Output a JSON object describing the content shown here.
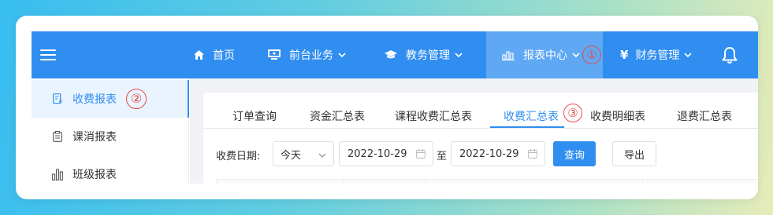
{
  "nav": {
    "items": [
      {
        "label": "首页",
        "icon": "home-icon"
      },
      {
        "label": "前台业务",
        "icon": "monitor-icon"
      },
      {
        "label": "教务管理",
        "icon": "graduation-cap-icon"
      },
      {
        "label": "报表中心",
        "icon": "bar-chart-icon",
        "active": true,
        "marker": "①"
      },
      {
        "label": "财务管理",
        "icon": "yen-icon"
      }
    ]
  },
  "sidebar": {
    "items": [
      {
        "label": "收费报表",
        "icon": "receipt-icon",
        "active": true,
        "marker": "②"
      },
      {
        "label": "课消报表",
        "icon": "clipboard-icon"
      },
      {
        "label": "班级报表",
        "icon": "bar-chart-icon"
      }
    ]
  },
  "tabs": [
    {
      "label": "订单查询"
    },
    {
      "label": "资金汇总表"
    },
    {
      "label": "课程收费汇总表"
    },
    {
      "label": "收费汇总表",
      "active": true,
      "marker": "③"
    },
    {
      "label": "收费明细表"
    },
    {
      "label": "退费汇总表"
    }
  ],
  "filter": {
    "label": "收费日期:",
    "range_select": "今天",
    "start_date": "2022-10-29",
    "to_label": "至",
    "end_date": "2022-10-29",
    "query_button": "查询",
    "export_button": "导出"
  },
  "colors": {
    "primary": "#2f8ef0",
    "nav_active": "#5ea8f4",
    "marker": "#e34b4b"
  }
}
